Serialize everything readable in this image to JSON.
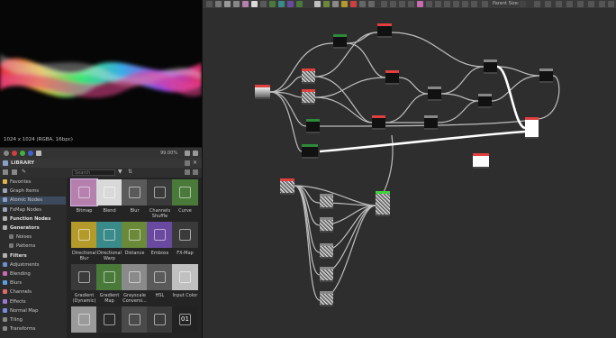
{
  "view2d": {
    "resolution_label": "1024 x 1024 (RGBA, 16bpc)",
    "zoom_label": "99.00%"
  },
  "library": {
    "title": "LIBRARY",
    "search_placeholder": "Search",
    "tree": [
      {
        "label": "Favorites",
        "kind": "item",
        "color": "#e0b44a"
      },
      {
        "label": "Graph Items",
        "kind": "item",
        "color": "#9aa6b8"
      },
      {
        "label": "Atomic Nodes",
        "kind": "item",
        "color": "#8aa0c8",
        "selected": true
      },
      {
        "label": "FxMap Nodes",
        "kind": "item",
        "color": "#9aa6b8"
      },
      {
        "label": "Function Nodes",
        "kind": "cat",
        "color": "#b0b0b0"
      },
      {
        "label": "Generators",
        "kind": "cat",
        "color": "#b0b0b0"
      },
      {
        "label": "Noises",
        "kind": "sub",
        "color": "#777"
      },
      {
        "label": "Patterns",
        "kind": "sub",
        "color": "#777"
      },
      {
        "label": "Filters",
        "kind": "cat",
        "color": "#b0b0b0"
      },
      {
        "label": "Adjustments",
        "kind": "item",
        "color": "#6c8fd0"
      },
      {
        "label": "Blending",
        "kind": "item",
        "color": "#c86bb0"
      },
      {
        "label": "Blurs",
        "kind": "item",
        "color": "#5aa0e0"
      },
      {
        "label": "Channels",
        "kind": "item",
        "color": "#e06a6a"
      },
      {
        "label": "Effects",
        "kind": "item",
        "color": "#9a7ad0"
      },
      {
        "label": "Normal Map",
        "kind": "item",
        "color": "#7a8ae0"
      },
      {
        "label": "Tiling",
        "kind": "item",
        "color": "#888"
      },
      {
        "label": "Transforms",
        "kind": "item",
        "color": "#888"
      }
    ],
    "tiles": [
      {
        "label": "Bitmap",
        "bg": "#b57fae",
        "icon": "bitmap-icon",
        "selected": true
      },
      {
        "label": "Blend",
        "bg": "#d9d9d9",
        "icon": "blend-icon"
      },
      {
        "label": "Blur",
        "bg": "#5a5a5a",
        "icon": "blur-drop-icon"
      },
      {
        "label": "Channels Shuffle",
        "bg": "#3a3a3a",
        "icon": "shuffle-icon"
      },
      {
        "label": "Curve",
        "bg": "#4a7a3a",
        "icon": "curve-icon"
      },
      {
        "label": "Directional Blur",
        "bg": "#b39a2a",
        "icon": "directional-blur-icon"
      },
      {
        "label": "Directional Warp",
        "bg": "#3a8a8a",
        "icon": "directional-warp-icon"
      },
      {
        "label": "Distance",
        "bg": "#6a8a3a",
        "icon": "distance-icon"
      },
      {
        "label": "Emboss",
        "bg": "#6a4aa0",
        "icon": "emboss-icon"
      },
      {
        "label": "FX-Map",
        "bg": "#3a3a3a",
        "icon": "fxmap-icon"
      },
      {
        "label": "Gradient (Dynamic)",
        "bg": "#3a3a3a",
        "icon": "gradient-dynamic-icon"
      },
      {
        "label": "Gradient Map",
        "bg": "#4a7a3a",
        "icon": "gradient-map-icon"
      },
      {
        "label": "Grayscale Conversi...",
        "bg": "#8a8a8a",
        "icon": "grayscale-icon"
      },
      {
        "label": "HSL",
        "bg": "#5a5a5a",
        "icon": "hsl-icon"
      },
      {
        "label": "Input Color",
        "bg": "#c0c0c0",
        "icon": "input-color-icon"
      },
      {
        "label": "",
        "bg": "#9a9a9a",
        "icon": "levels-icon"
      },
      {
        "label": "",
        "bg": "#2a2a2a",
        "icon": "histogram-icon"
      },
      {
        "label": "",
        "bg": "#4a4a4a",
        "icon": "color-wheel-icon"
      },
      {
        "label": "",
        "bg": "#3a3a3a",
        "icon": "transform-icon"
      },
      {
        "label": "",
        "bg": "#222",
        "icon": "uniform-color-icon",
        "text": "01"
      }
    ]
  },
  "graph": {
    "parent_size_label": "Parent Size:"
  }
}
